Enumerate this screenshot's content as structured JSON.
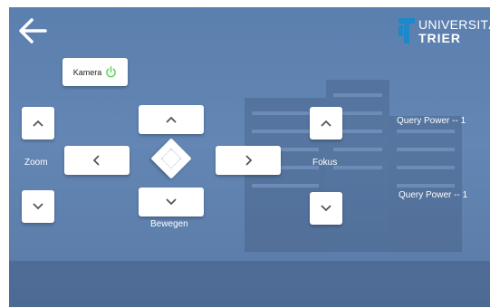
{
  "header": {
    "back_icon": "arrow-left-icon",
    "logo": {
      "line1": "UNIVERSITÄT",
      "line2": "TRIER",
      "mark_color": "#1e88c8"
    }
  },
  "camera": {
    "label": "Kamera",
    "power_icon": "power-icon",
    "power_color": "#5cd65c"
  },
  "zoom": {
    "label": "Zoom",
    "up_icon": "chevron-up-icon",
    "down_icon": "chevron-down-icon"
  },
  "move": {
    "label": "Bewegen",
    "up_icon": "chevron-up-icon",
    "down_icon": "chevron-down-icon",
    "left_icon": "chevron-left-icon",
    "right_icon": "chevron-right-icon",
    "center_icon": "center-diamond-icon"
  },
  "focus": {
    "label": "Fokus",
    "up_icon": "chevron-up-icon",
    "down_icon": "chevron-down-icon"
  },
  "query": {
    "power_1": "Query Power -- 1",
    "power_2": "Query Power -- 1"
  },
  "colors": {
    "background": "#6184b2",
    "button": "#ffffff",
    "icon": "#555555"
  }
}
